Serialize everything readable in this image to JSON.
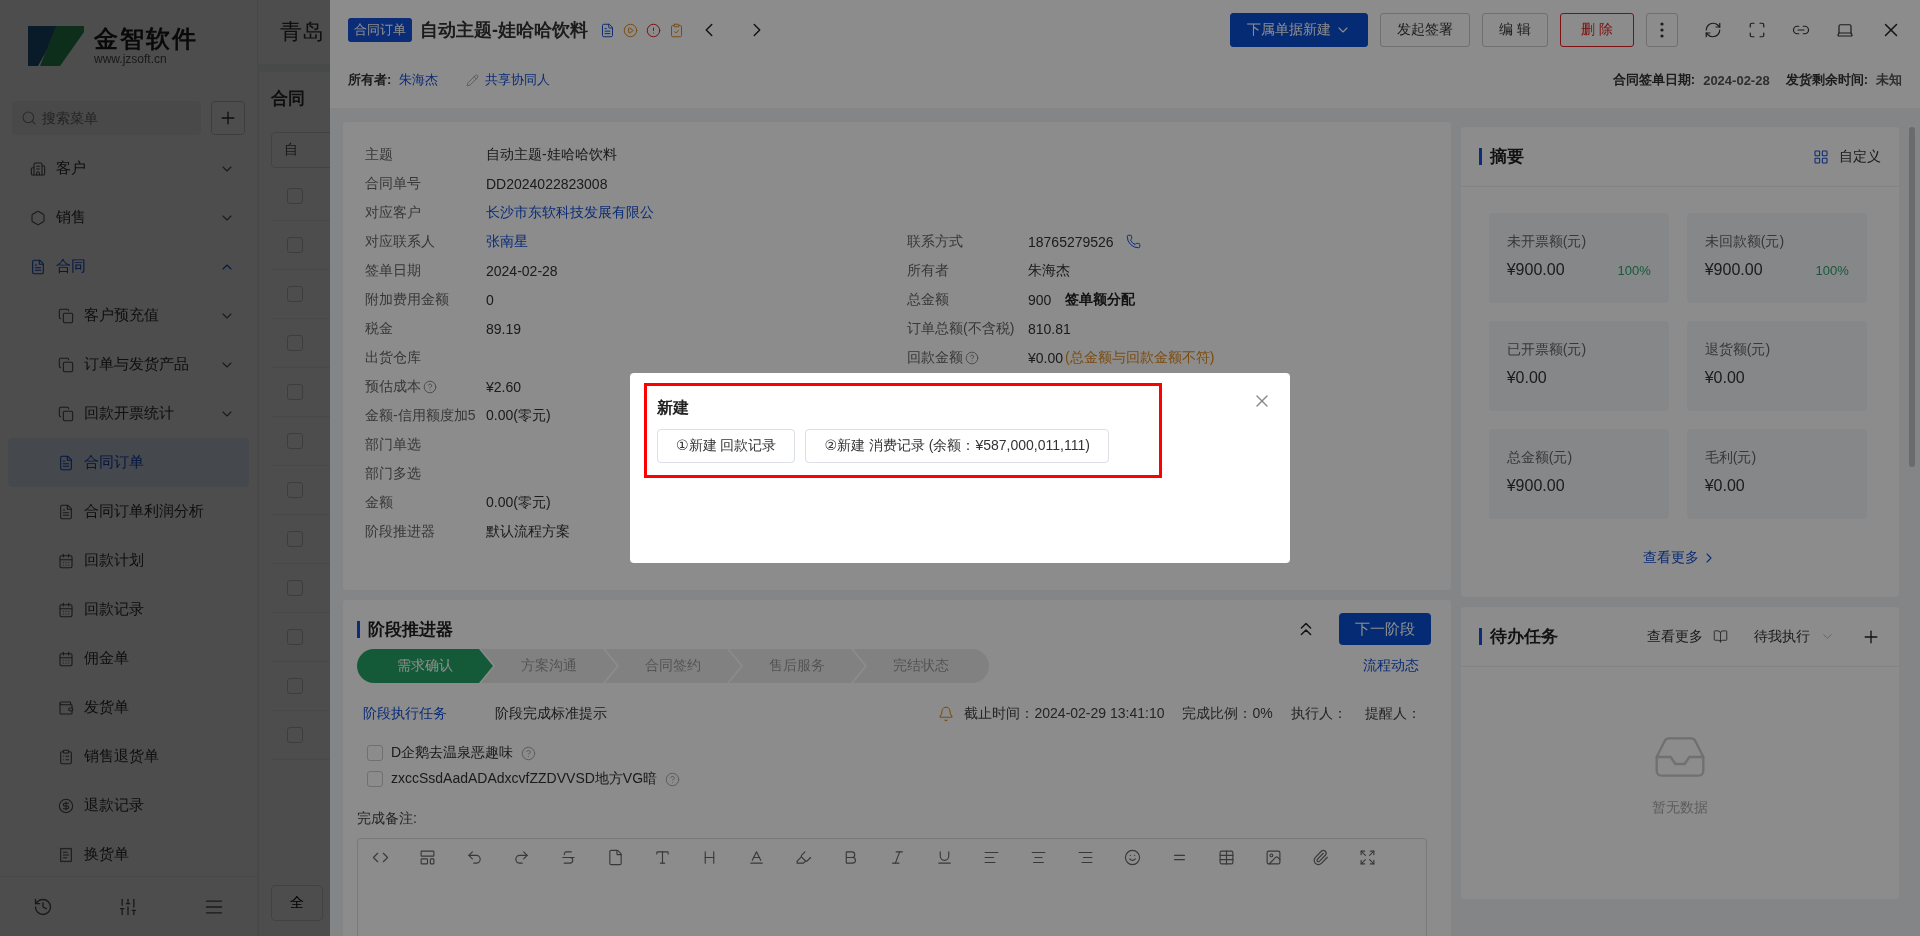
{
  "sidebar": {
    "logo": {
      "name": "金智软件",
      "url": "www.jzsoft.cn"
    },
    "search": {
      "placeholder": "搜索菜单"
    },
    "items": [
      {
        "label": "客户",
        "expanded": false
      },
      {
        "label": "销售",
        "expanded": false
      },
      {
        "label": "合同",
        "expanded": true,
        "children": [
          {
            "label": "客户预充值",
            "selected": false,
            "expanded": false
          },
          {
            "label": "订单与发货产品",
            "selected": false,
            "expanded": false
          },
          {
            "label": "回款开票统计",
            "selected": false,
            "expanded": false
          },
          {
            "label": "合同订单",
            "selected": true
          },
          {
            "label": "合同订单利润分析",
            "selected": false
          },
          {
            "label": "回款计划",
            "selected": false
          },
          {
            "label": "回款记录",
            "selected": false
          },
          {
            "label": "佣金单",
            "selected": false
          },
          {
            "label": "发货单",
            "selected": false
          },
          {
            "label": "销售退货单",
            "selected": false
          },
          {
            "label": "退款记录",
            "selected": false
          },
          {
            "label": "换货单",
            "selected": false
          }
        ]
      }
    ]
  },
  "list": {
    "company": "青岛",
    "title": "合同",
    "filter": "自",
    "rows": [
      {
        "checked": false
      },
      {
        "checked": false
      },
      {
        "checked": false
      },
      {
        "checked": false
      },
      {
        "checked": false
      },
      {
        "checked": false
      },
      {
        "checked": false
      },
      {
        "checked": false
      },
      {
        "checked": false
      },
      {
        "checked": false
      },
      {
        "checked": false
      },
      {
        "checked": false
      }
    ],
    "footer_button": "全"
  },
  "drawer": {
    "tag": "合同订单",
    "title": "自动主题-娃哈哈饮料",
    "actions": [
      {
        "label": "下属单据新建",
        "kind": "primary"
      },
      {
        "label": "发起签署",
        "kind": "default"
      },
      {
        "label": "编 辑",
        "kind": "default"
      },
      {
        "label": "删 除",
        "kind": "danger"
      }
    ],
    "owner_label": "所有者:",
    "owner": "朱海杰",
    "share": "共享协同人",
    "meta": [
      {
        "label": "合同签单日期:",
        "value": "2024-02-28"
      },
      {
        "label": "发货剩余时间:",
        "value": "未知"
      }
    ],
    "detail": [
      {
        "left": {
          "label": "主题",
          "value": "自动主题-娃哈哈饮料"
        }
      },
      {
        "left": {
          "label": "合同单号",
          "value": "DD2024022823008"
        }
      },
      {
        "left": {
          "label": "对应客户",
          "value": "长沙市东软科技发展有限公",
          "link": true
        }
      },
      {
        "left": {
          "label": "对应联系人",
          "value": "张南星",
          "link": true
        },
        "right": {
          "label": "联系方式",
          "value": "18765279526",
          "phone": true
        }
      },
      {
        "left": {
          "label": "签单日期",
          "value": "2024-02-28"
        },
        "right": {
          "label": "所有者",
          "value": "朱海杰"
        }
      },
      {
        "left": {
          "label": "附加费用金额",
          "value": "0"
        },
        "right": {
          "label": "总金额",
          "value": "900",
          "action": "签单额分配"
        }
      },
      {
        "left": {
          "label": "税金",
          "value": "89.19"
        },
        "right": {
          "label": "订单总额(不含税)",
          "value": "810.81"
        }
      },
      {
        "left": {
          "label": "出货仓库"
        },
        "right": {
          "label": "回款金额",
          "help": true,
          "value": "¥0.00",
          "warning": "(总金额与回款金额不符)"
        }
      },
      {
        "left": {
          "label": "预估成本",
          "help": true,
          "value": "¥2.60"
        }
      },
      {
        "left": {
          "label": "金额-信用额度加5",
          "value": "0.00(零元)"
        }
      },
      {
        "left": {
          "label": "部门单选"
        }
      },
      {
        "left": {
          "label": "部门多选"
        }
      },
      {
        "left": {
          "label": "金额",
          "value": "0.00(零元)"
        }
      },
      {
        "left": {
          "label": "阶段推进器",
          "value": "默认流程方案"
        }
      }
    ],
    "stage": {
      "title": "阶段推进器",
      "next": "下一阶段",
      "log": "流程动态",
      "steps": [
        {
          "label": "需求确认",
          "selected": true
        },
        {
          "label": "方案沟通",
          "selected": false
        },
        {
          "label": "合同签约",
          "selected": false
        },
        {
          "label": "售后服务",
          "selected": false
        },
        {
          "label": "完结状态",
          "selected": false
        }
      ],
      "tabs": [
        {
          "label": "阶段执行任务",
          "selected": true
        },
        {
          "label": "阶段完成标准提示",
          "selected": false
        }
      ],
      "info": [
        "截止时间：2024-02-29 13:41:10",
        "完成比例：0%",
        "执行人：",
        "提醒人："
      ],
      "tasks": [
        {
          "label": "D企鹅去温泉恶趣味",
          "checked": false
        },
        {
          "label": "zxccSsdAadADAdxcvfZZDVVSD地方VG暗",
          "checked": false
        }
      ],
      "notes_label": "完成备注:"
    },
    "summary": {
      "title": "摘要",
      "customize": "自定义",
      "metrics": [
        {
          "label": "未开票额(元)",
          "value": "¥900.00",
          "percent": "100%"
        },
        {
          "label": "未回款额(元)",
          "value": "¥900.00",
          "percent": "100%"
        },
        {
          "label": "已开票额(元)",
          "value": "¥0.00"
        },
        {
          "label": "退货额(元)",
          "value": "¥0.00"
        },
        {
          "label": "总金额(元)",
          "value": "¥900.00"
        },
        {
          "label": "毛利(元)",
          "value": "¥0.00"
        }
      ],
      "more": "查看更多"
    },
    "todo": {
      "title": "待办任务",
      "more": "查看更多",
      "filter": "待我执行",
      "empty": "暂无数据"
    }
  },
  "modal": {
    "title": "新建",
    "highlighted": true,
    "buttons": [
      "①新建 回款记录",
      "②新建 消费记录 (余额：¥587,000,011,111)"
    ]
  }
}
